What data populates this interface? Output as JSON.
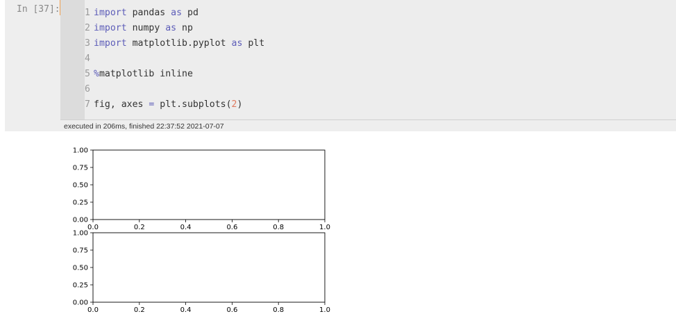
{
  "cell": {
    "prompt": "In [37]:",
    "lines": [
      {
        "num": "1",
        "parts": [
          {
            "t": "import",
            "c": "kw"
          },
          {
            "t": " pandas ",
            "c": ""
          },
          {
            "t": "as",
            "c": "kw"
          },
          {
            "t": " pd",
            "c": ""
          }
        ]
      },
      {
        "num": "2",
        "parts": [
          {
            "t": "import",
            "c": "kw"
          },
          {
            "t": " numpy ",
            "c": ""
          },
          {
            "t": "as",
            "c": "kw"
          },
          {
            "t": " np",
            "c": ""
          }
        ]
      },
      {
        "num": "3",
        "parts": [
          {
            "t": "import",
            "c": "kw"
          },
          {
            "t": " matplotlib.pyplot ",
            "c": ""
          },
          {
            "t": "as",
            "c": "kw"
          },
          {
            "t": " plt",
            "c": ""
          }
        ]
      },
      {
        "num": "4",
        "parts": []
      },
      {
        "num": "5",
        "parts": [
          {
            "t": "%",
            "c": "magic"
          },
          {
            "t": "matplotlib inline",
            "c": ""
          }
        ]
      },
      {
        "num": "6",
        "parts": []
      },
      {
        "num": "7",
        "parts": [
          {
            "t": "fig, axes ",
            "c": ""
          },
          {
            "t": "=",
            "c": "op"
          },
          {
            "t": " plt.subplots(",
            "c": ""
          },
          {
            "t": "2",
            "c": "num"
          },
          {
            "t": ")",
            "c": ""
          }
        ]
      }
    ],
    "timing": "executed in 206ms, finished 22:37:52 2021-07-07"
  },
  "chart_data": [
    {
      "type": "line",
      "series": [],
      "xlim": [
        0.0,
        1.0
      ],
      "ylim": [
        0.0,
        1.0
      ],
      "xticks": [
        "0.0",
        "0.2",
        "0.4",
        "0.6",
        "0.8",
        "1.0"
      ],
      "yticks": [
        "0.00",
        "0.25",
        "0.50",
        "0.75",
        "1.00"
      ],
      "grid": false
    },
    {
      "type": "line",
      "series": [],
      "xlim": [
        0.0,
        1.0
      ],
      "ylim": [
        0.0,
        1.0
      ],
      "xticks": [
        "0.0",
        "0.2",
        "0.4",
        "0.6",
        "0.8",
        "1.0"
      ],
      "yticks": [
        "0.00",
        "0.25",
        "0.50",
        "0.75",
        "1.00"
      ],
      "grid": false
    }
  ]
}
